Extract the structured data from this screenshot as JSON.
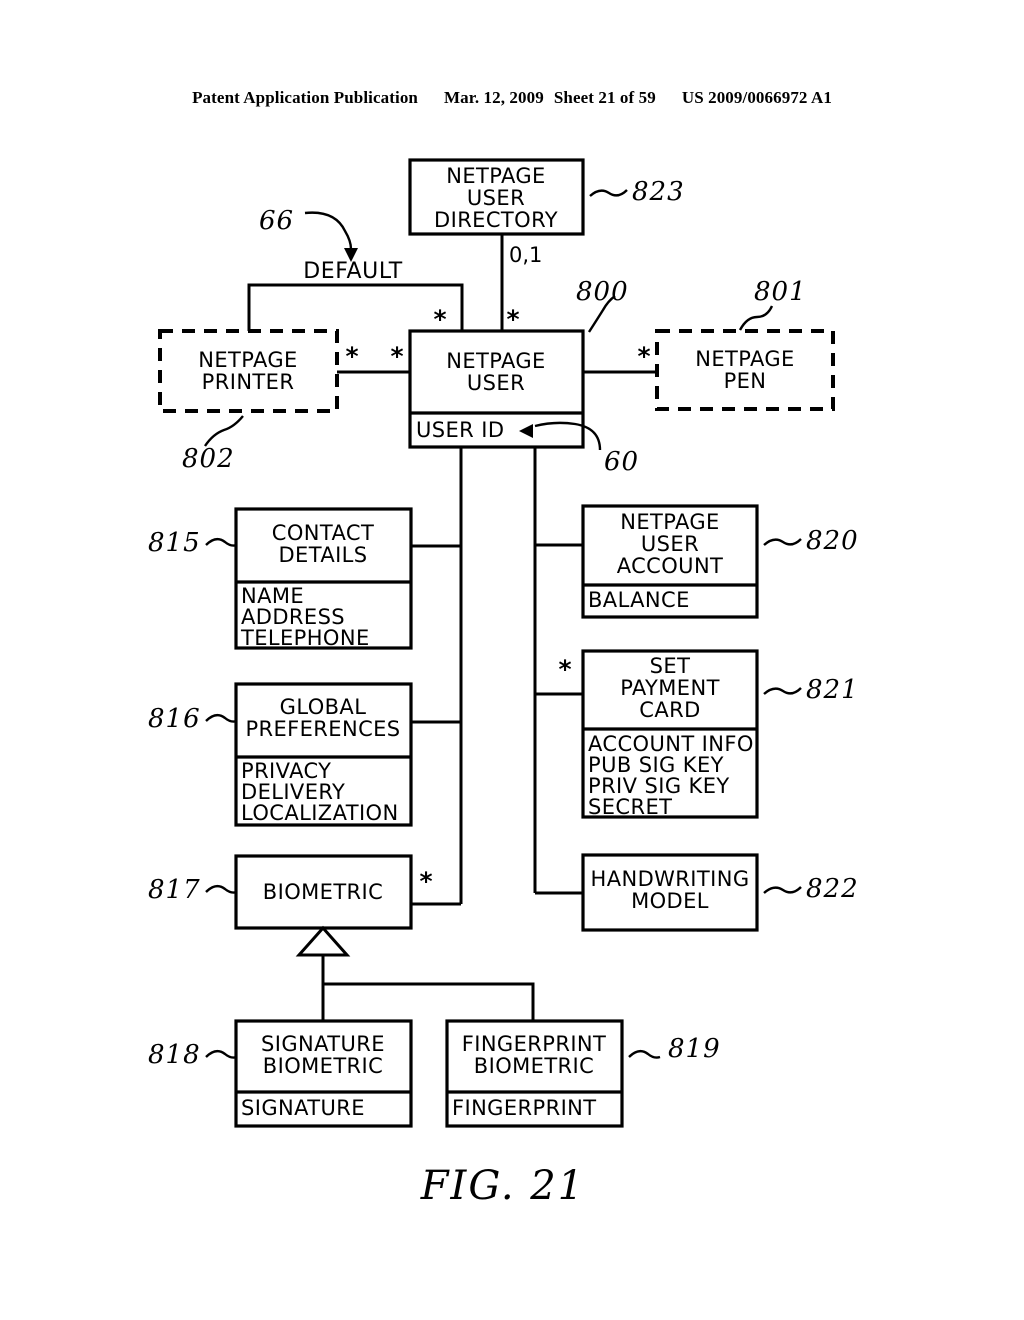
{
  "header": {
    "publication": "Patent Application Publication",
    "date": "Mar. 12, 2009",
    "sheet": "Sheet 21 of 59",
    "patent_number": "US 2009/0066972 A1"
  },
  "figure": {
    "caption": "FIG. 21",
    "type": "uml-class-diagram"
  },
  "labels": {
    "default": "DEFAULT",
    "cardinality_01": "0,1",
    "star": "*"
  },
  "entities": {
    "netpage_user_directory": {
      "title_lines": [
        "NETPAGE",
        "USER",
        "DIRECTORY"
      ],
      "ref": "823",
      "attributes": []
    },
    "netpage_printer": {
      "title_lines": [
        "NETPAGE",
        "PRINTER"
      ],
      "ref": "802",
      "style": "dashed",
      "attributes": []
    },
    "netpage_user": {
      "title_lines": [
        "NETPAGE",
        "USER"
      ],
      "ref": "800",
      "attributes": [
        "USER ID"
      ],
      "attribute_ref": "60"
    },
    "netpage_pen": {
      "title_lines": [
        "NETPAGE",
        "PEN"
      ],
      "ref": "801",
      "style": "dashed",
      "attributes": []
    },
    "contact_details": {
      "title_lines": [
        "CONTACT",
        "DETAILS"
      ],
      "ref": "815",
      "attributes": [
        "NAME",
        "ADDRESS",
        "TELEPHONE"
      ]
    },
    "global_preferences": {
      "title_lines": [
        "GLOBAL",
        "PREFERENCES"
      ],
      "ref": "816",
      "attributes": [
        "PRIVACY",
        "DELIVERY",
        "LOCALIZATION"
      ]
    },
    "biometric": {
      "title_lines": [
        "BIOMETRIC"
      ],
      "ref": "817",
      "attributes": []
    },
    "signature_biometric": {
      "title_lines": [
        "SIGNATURE",
        "BIOMETRIC"
      ],
      "ref": "818",
      "attributes": [
        "SIGNATURE"
      ]
    },
    "fingerprint_biometric": {
      "title_lines": [
        "FINGERPRINT",
        "BIOMETRIC"
      ],
      "ref": "819",
      "attributes": [
        "FINGERPRINT"
      ]
    },
    "netpage_user_account": {
      "title_lines": [
        "NETPAGE",
        "USER",
        "ACCOUNT"
      ],
      "ref": "820",
      "attributes": [
        "BALANCE"
      ]
    },
    "set_payment_card": {
      "title_lines": [
        "SET",
        "PAYMENT",
        "CARD"
      ],
      "ref": "821",
      "attributes": [
        "ACCOUNT INFO",
        "PUB SIG KEY",
        "PRIV SIG KEY",
        "SECRET"
      ]
    },
    "handwriting_model": {
      "title_lines": [
        "HANDWRITING",
        "MODEL"
      ],
      "ref": "822",
      "attributes": []
    }
  },
  "callouts": {
    "default_arrow_ref": "66"
  }
}
